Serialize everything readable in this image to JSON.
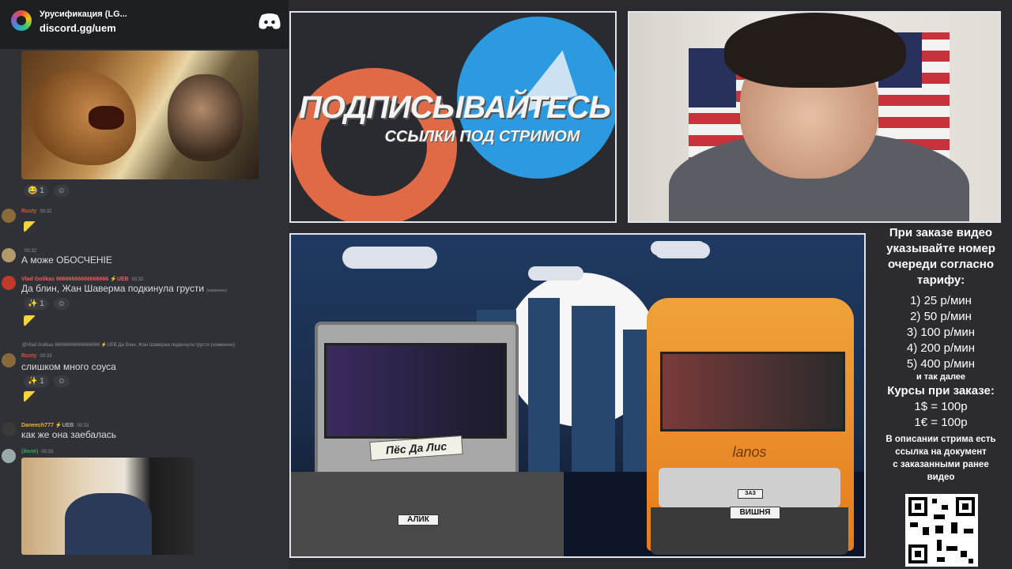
{
  "discord": {
    "server_name": "Урусификация (LG...",
    "invite": "discord.gg/uem",
    "image1_reactions": [
      {
        "emoji": "😂",
        "count": "1"
      },
      {
        "emoji": "☺",
        "count": ""
      }
    ],
    "messages": [
      {
        "user": "Rusty",
        "time": "00:32",
        "text": "",
        "sticker": true,
        "color": "#e74c3c"
      },
      {
        "user": "",
        "time": "00:32",
        "text": "А може ОБОСЧЕНІЕ",
        "color": "#3ba55c"
      },
      {
        "user": "Vlad Golikas",
        "badges": "66666666666666666 ⚡UEB",
        "time": "00:32",
        "text": "Да блин, Жан Шаверма подкинула грусти",
        "edited": "(изменено)",
        "color": "#e06060"
      },
      {
        "reply": "@Vlad Golikas 66666666666666666 ⚡UEB Да блин, Жан Шаверма подкинула грусти (изменено)",
        "user": "Rusty",
        "time": "00:33",
        "text": "слишком много соуса",
        "color": "#e74c3c"
      },
      {
        "user": "Daneech777",
        "badges": "⚡UEB",
        "time": "00:33",
        "text": "как же она заебалась",
        "color": "#f0b232"
      },
      {
        "user": "(йоле)",
        "time": "00:33",
        "text": "",
        "color": "#3ba55c"
      }
    ],
    "reaction_count": "1"
  },
  "subscribe": {
    "title": "ПОДПИСЫВАЙТЕСЬ",
    "subtitle": "ССЫЛКИ ПОД СТРИМОМ"
  },
  "scene": {
    "left_tag": "Пёс Да Лис",
    "left_plate": "АЛИК",
    "right_plate": "ВИШНЯ",
    "van_brand": "lanos",
    "van_plate_small": "ЗАЗ"
  },
  "info": {
    "heading_lines": [
      "При заказе видео",
      "указывайте номер",
      "очереди согласно",
      "тарифу:"
    ],
    "tariffs": [
      "1) 25 р/мин",
      "2) 50 р/мин",
      "3) 100 р/мин",
      "4) 200 р/мин",
      "5) 400 р/мин"
    ],
    "etc": "и так далее",
    "rates_title": "Курсы при заказе:",
    "rates": [
      "1$ = 100р",
      "1€ = 100р"
    ],
    "desc_lines": [
      "В описании стрима есть",
      "ссылка на документ",
      "с заказанными ранее",
      "видео"
    ]
  },
  "colors": {
    "telegram": "#2c9ae0",
    "patreon": "#e06a45",
    "van": "#e57b1f"
  }
}
